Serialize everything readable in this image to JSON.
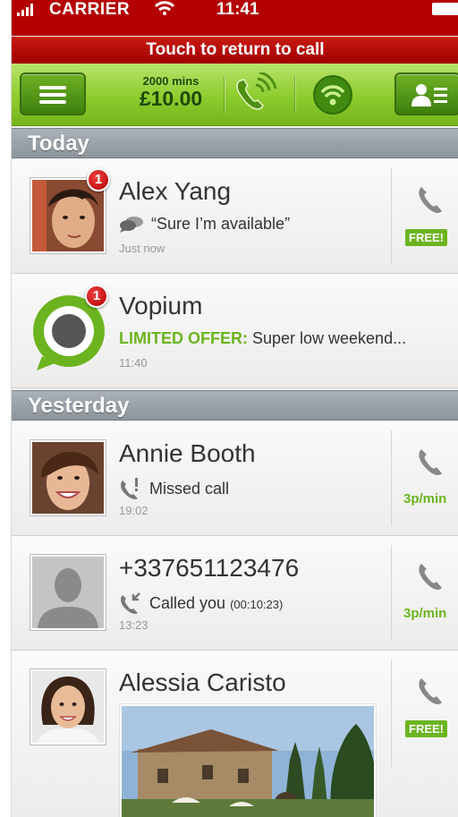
{
  "status": {
    "carrier": "CARRIER",
    "time": "11:41"
  },
  "banner": {
    "return_to_call": "Touch to return to call"
  },
  "toolbar": {
    "credit_mins": "2000 mins",
    "credit_amount": "£10.00"
  },
  "sections": {
    "today": "Today",
    "yesterday": "Yesterday"
  },
  "conversations": [
    {
      "name": "Alex Yang",
      "badge": "1",
      "preview": "“Sure I’m available”",
      "time": "Just now",
      "call_rate": "FREE!"
    },
    {
      "name": "Vopium",
      "badge": "1",
      "offer_label": "LIMITED OFFER:",
      "preview": " Super low weekend...",
      "time": "11:40"
    },
    {
      "name": "Annie Booth",
      "preview": "Missed call",
      "time": "19:02",
      "call_rate": "3p/min"
    },
    {
      "name": "+337651123476",
      "preview": "Called you ",
      "duration": "(00:10:23)",
      "time": "13:23",
      "call_rate": "3p/min"
    },
    {
      "name": "Alessia Caristo",
      "call_rate": "FREE!"
    }
  ],
  "colors": {
    "accent_green": "#6cb41f",
    "banner_red": "#b40000",
    "header_gray": "#8c949c"
  },
  "icons": [
    "signal-icon",
    "wifi-icon",
    "battery-icon",
    "menu-icon",
    "call-waves-icon",
    "wifi-call-icon",
    "contacts-icon",
    "chat-bubble-icon",
    "missed-call-icon",
    "incoming-call-icon",
    "phone-icon"
  ]
}
